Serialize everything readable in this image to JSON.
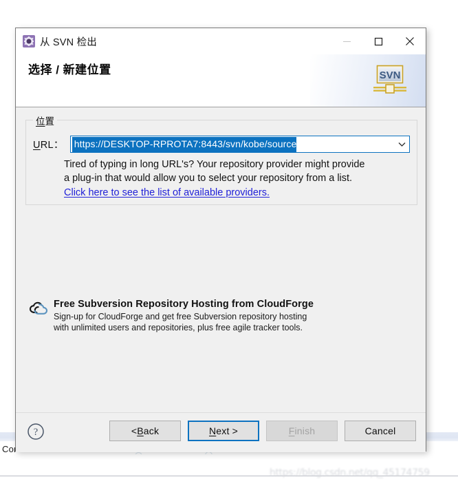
{
  "background": {
    "console_label": "Con",
    "watermark": "https://blog.csdn.net/qq_45174759"
  },
  "dialog": {
    "titlebar": {
      "icon": "svn-checkout-gear-icon",
      "title": "从 SVN 检出",
      "minimize_label": "—",
      "maximize_label": "□",
      "close_label": "✕"
    },
    "banner": {
      "heading": "选择 / 新建位置",
      "logo_text": "SVN"
    },
    "location_group": {
      "legend_mnemonic": "位",
      "legend_rest": "置",
      "url_label_mnemonic": "U",
      "url_label_rest": "RL：",
      "url_value": "https://DESKTOP-RPROTA7:8443/svn/kobe/source",
      "url_placeholder": "https://",
      "dropdown_icon": "chevron-down-icon",
      "hint_line1": "Tired of typing in long URL's?  Your repository provider might provide",
      "hint_line2": "a plug-in that would allow you to select your repository from a list.",
      "provider_link": "Click here to see the list of available providers."
    },
    "promo": {
      "icon": "cloudforge-cloud-icon",
      "title": "Free Subversion Repository Hosting from CloudForge",
      "sub_line1": "Sign-up for CloudForge and get free Subversion repository hosting",
      "sub_line2": "with unlimited users and repositories, plus free agile tracker tools."
    },
    "footer": {
      "help_icon": "help-question-icon",
      "buttons": [
        {
          "prefix": "< ",
          "mnemonic": "B",
          "rest": "ack",
          "state": "enabled"
        },
        {
          "prefix": "",
          "mnemonic": "N",
          "rest": "ext >",
          "state": "default"
        },
        {
          "prefix": "",
          "mnemonic": "F",
          "rest": "inish",
          "state": "disabled"
        },
        {
          "prefix": "",
          "mnemonic": "",
          "rest": "Cancel",
          "state": "enabled"
        }
      ]
    }
  },
  "colors": {
    "accent": "#0c72c0",
    "link": "#2020d8",
    "dialog_bg": "#f0f0f0",
    "title_icon_bg": "#8e73b4"
  }
}
